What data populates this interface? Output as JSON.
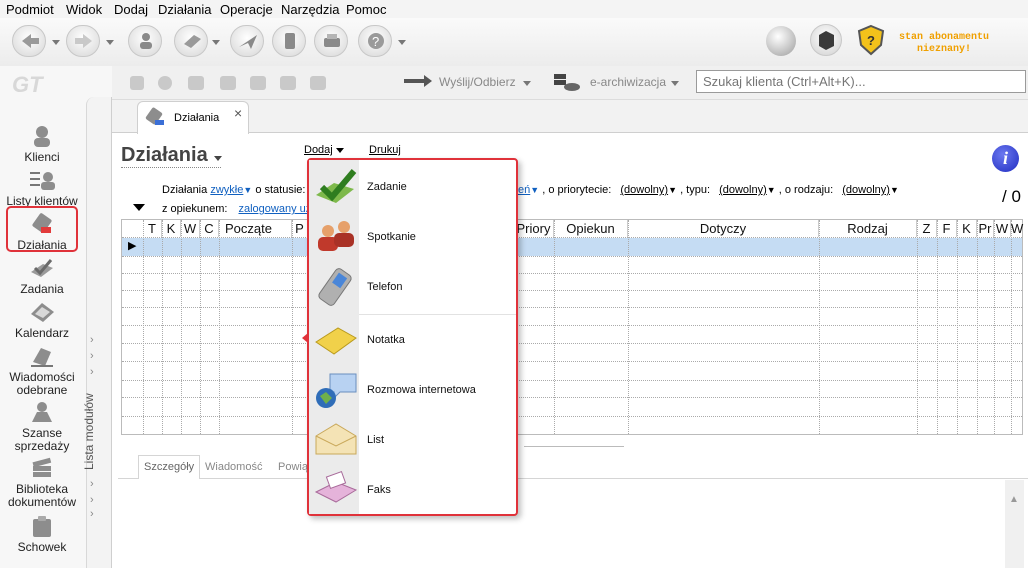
{
  "menu": [
    "Podmiot",
    "Widok",
    "Dodaj",
    "Działania",
    "Operacje",
    "Narzędzia",
    "Pomoc"
  ],
  "subscription": {
    "line1": "stan abonamentu",
    "line2": "nieznany!",
    "color": "#f0a000"
  },
  "subtoolbar": {
    "send_label": "Wyślij/Odbierz",
    "archive_label": "e-archiwizacja",
    "search_placeholder": "Szukaj klienta (Ctrl+Alt+K)..."
  },
  "sidebar": {
    "items": [
      {
        "label": "Klienci",
        "icon": "clients-icon"
      },
      {
        "label": "Listy klientów",
        "icon": "client-lists-icon"
      },
      {
        "label": "Działania",
        "icon": "activities-icon",
        "selected": true
      },
      {
        "label": "Zadania",
        "icon": "tasks-icon"
      },
      {
        "label": "Kalendarz",
        "icon": "calendar-icon"
      },
      {
        "label": "Wiadomości odebrane",
        "icon": "messages-icon"
      },
      {
        "label": "Szanse sprzedaży",
        "icon": "sales-icon"
      },
      {
        "label": "Biblioteka dokumentów",
        "icon": "library-icon"
      },
      {
        "label": "Schowek",
        "icon": "clipboard-icon"
      }
    ],
    "vertical_label": "Lista modułów"
  },
  "tab": {
    "label": "Działania",
    "close": "×"
  },
  "page": {
    "title": "Działania",
    "add_label": "Dodaj",
    "print_label": "Drukuj",
    "count": "/ 0"
  },
  "filter": {
    "prefix": "Działania",
    "type_value": "zwykłe",
    "status_label": "o statusie:",
    "status_value_tail": "eń",
    "priority_label": ", o priorytecie:",
    "priority_value": "(dowolny)",
    "type_label": ", typu:",
    "type2_value": "(dowolny)",
    "kind_label": ", o rodzaju:",
    "kind_value": "(dowolny)",
    "owner_label": "z opiekunem:",
    "owner_value": "zalogowany uż"
  },
  "grid": {
    "columns": [
      "T",
      "K",
      "W",
      "C",
      "Począte",
      "P",
      "Priory",
      "Opiekun",
      "Dotyczy",
      "Rodzaj",
      "Z",
      "F",
      "K",
      "Pr",
      "W",
      "W"
    ]
  },
  "dropdown": {
    "items": [
      {
        "label": "Zadanie",
        "icon": "task-check-icon"
      },
      {
        "label": "Spotkanie",
        "icon": "meeting-icon"
      },
      {
        "label": "Telefon",
        "icon": "phone-icon"
      },
      {
        "label": "Notatka",
        "icon": "note-icon"
      },
      {
        "label": "Rozmowa internetowa",
        "icon": "chat-icon"
      },
      {
        "label": "List",
        "icon": "letter-icon"
      },
      {
        "label": "Faks",
        "icon": "fax-icon"
      }
    ]
  },
  "bottom_tabs": [
    "Szczegóły",
    "Wiadomość",
    "Powią"
  ],
  "colors": {
    "highlight": "#e0323a",
    "link": "#1060c0",
    "row_selected": "#c5dcf3"
  }
}
